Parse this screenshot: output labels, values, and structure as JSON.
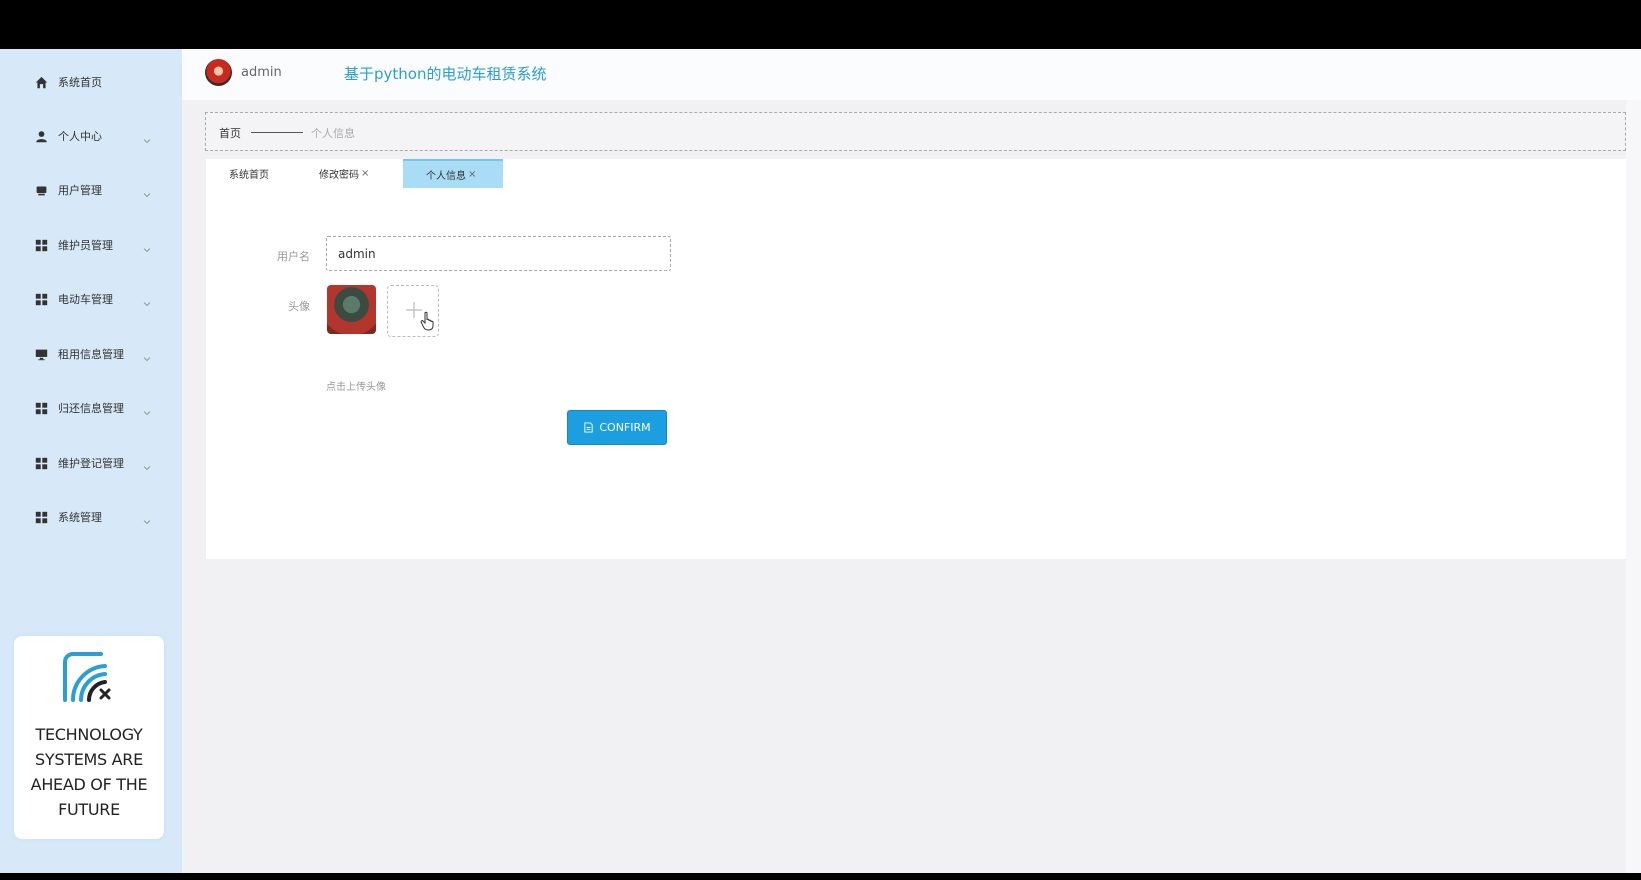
{
  "header": {
    "user_name": "admin",
    "title": "基于python的电动车租赁系统"
  },
  "sidebar": {
    "items": [
      {
        "label": "系统首页",
        "icon": "home-icon",
        "has_chevron": false
      },
      {
        "label": "个人中心",
        "icon": "user-icon",
        "has_chevron": true
      },
      {
        "label": "用户管理",
        "icon": "folder-icon",
        "has_chevron": true
      },
      {
        "label": "维护员管理",
        "icon": "grid-icon",
        "has_chevron": true
      },
      {
        "label": "电动车管理",
        "icon": "grid-icon",
        "has_chevron": true
      },
      {
        "label": "租用信息管理",
        "icon": "monitor-icon",
        "has_chevron": true
      },
      {
        "label": "归还信息管理",
        "icon": "grid-icon",
        "has_chevron": true
      },
      {
        "label": "维护登记管理",
        "icon": "grid-icon",
        "has_chevron": true
      },
      {
        "label": "系统管理",
        "icon": "grid-icon",
        "has_chevron": true
      }
    ],
    "promo_text": "TECHNOLOGY\nSYSTEMS  ARE\nAHEAD OF THE\nFUTURE"
  },
  "breadcrumb": {
    "home": "首页",
    "current": "个人信息"
  },
  "tabs": [
    {
      "label": "系统首页",
      "closable": false,
      "active": false
    },
    {
      "label": "修改密码",
      "closable": true,
      "active": false
    },
    {
      "label": "个人信息",
      "closable": true,
      "active": true
    }
  ],
  "form": {
    "username_label": "用户名",
    "username_value": "admin",
    "avatar_label": "头像",
    "upload_hint": "点击上传头像",
    "confirm_label": "CONFIRM"
  },
  "colors": {
    "sidebar_bg": "#d7e9f8",
    "accent": "#1b9fe0",
    "title_color": "#2a9ed6",
    "active_tab": "#a9dcf5"
  }
}
